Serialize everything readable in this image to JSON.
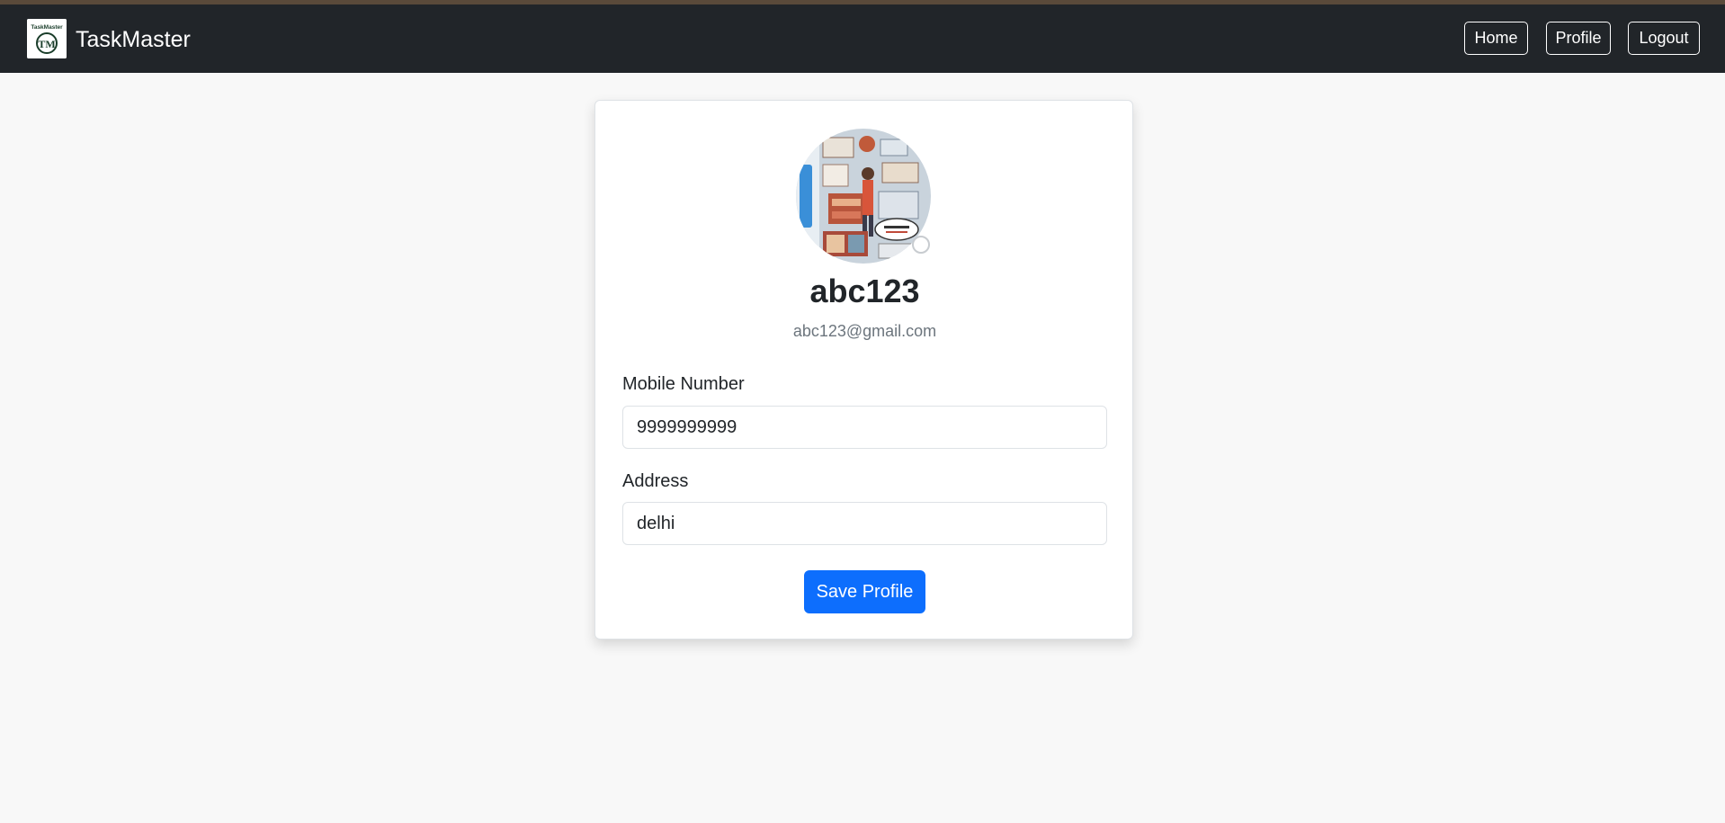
{
  "app": {
    "name": "TaskMaster",
    "logo_text": "TaskMaster",
    "logo_mark": "TM"
  },
  "nav": {
    "home_label": "Home",
    "profile_label": "Profile",
    "logout_label": "Logout"
  },
  "profile": {
    "username": "abc123",
    "email": "abc123@gmail.com",
    "avatar_icon": "profile-photo"
  },
  "form": {
    "mobile_label": "Mobile Number",
    "mobile_value": "9999999999",
    "address_label": "Address",
    "address_value": "delhi",
    "save_label": "Save Profile"
  },
  "colors": {
    "navbar": "#212529",
    "primary": "#0d6efd",
    "background": "#f8f8f8"
  }
}
